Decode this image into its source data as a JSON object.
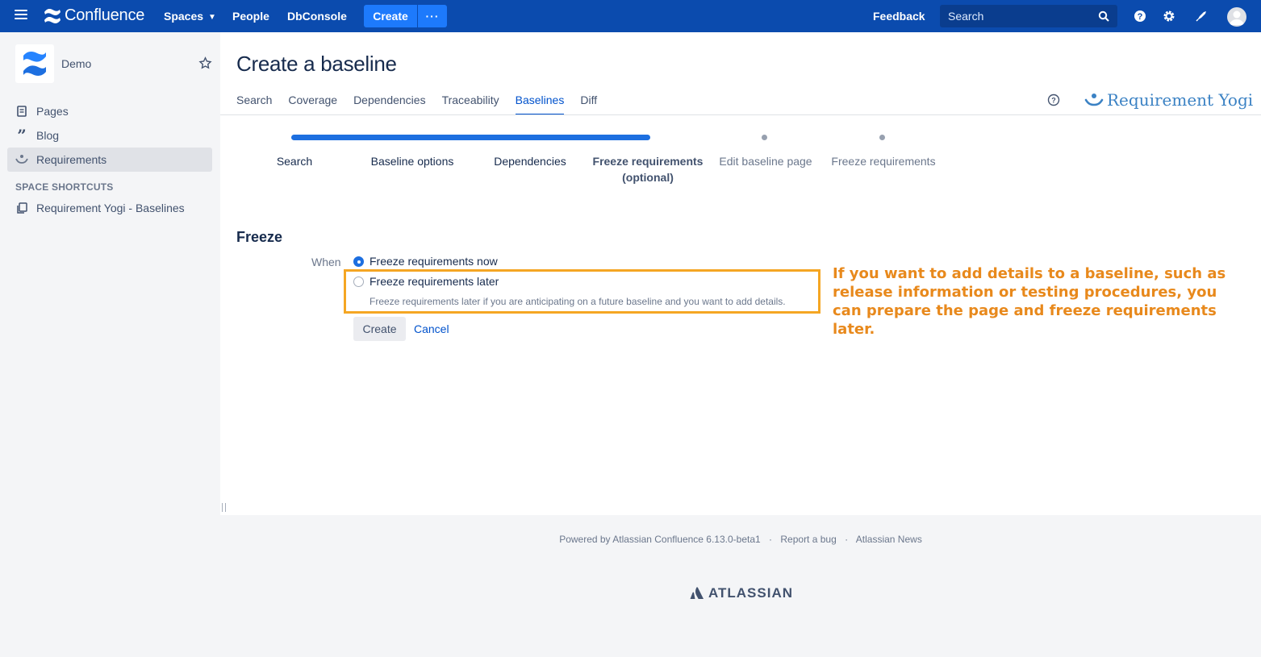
{
  "topnav": {
    "brand": "Confluence",
    "spaces": "Spaces",
    "people": "People",
    "dbconsole": "DbConsole",
    "create": "Create",
    "more": "···",
    "feedback": "Feedback",
    "search_placeholder": "Search"
  },
  "sidebar": {
    "space_name": "Demo",
    "items": [
      {
        "label": "Pages",
        "icon": "pages-icon"
      },
      {
        "label": "Blog",
        "icon": "blog-icon"
      },
      {
        "label": "Requirements",
        "icon": "requirements-icon"
      }
    ],
    "shortcuts_heading": "SPACE SHORTCUTS",
    "shortcuts": [
      {
        "label": "Requirement Yogi - Baselines",
        "icon": "copy-icon"
      }
    ]
  },
  "main": {
    "title": "Create a baseline",
    "tabs": [
      {
        "label": "Search"
      },
      {
        "label": "Coverage"
      },
      {
        "label": "Dependencies"
      },
      {
        "label": "Traceability"
      },
      {
        "label": "Baselines",
        "active": true
      },
      {
        "label": "Diff"
      }
    ],
    "brand_logo": "Requirement Yogi",
    "steps": [
      {
        "label": "Search"
      },
      {
        "label": "Baseline options"
      },
      {
        "label": "Dependencies"
      },
      {
        "label": "Freeze requirements (optional)"
      },
      {
        "label": "Edit baseline page"
      },
      {
        "label": "Freeze requirements"
      }
    ],
    "freeze_heading": "Freeze",
    "when_label": "When",
    "option_now": "Freeze requirements now",
    "option_later": "Freeze requirements later",
    "option_later_desc": "Freeze requirements later if you are anticipating on a future baseline and you want to add details.",
    "annotation_lines": [
      "If you want to add details to a baseline, such as",
      "release information or testing procedures, you",
      "can prepare the page and freeze requirements later."
    ],
    "create_button": "Create",
    "cancel_link": "Cancel"
  },
  "footer": {
    "powered_by": "Powered by Atlassian Confluence 6.13.0-beta1",
    "sep": "·",
    "report_bug": "Report a bug",
    "news": "Atlassian News",
    "atlassian": "ATLASSIAN"
  },
  "colors": {
    "nav_bg": "#0B4BAE",
    "create_btn": "#1D7AFC",
    "active_tab": "#0052CC",
    "annotation": "#E8891C",
    "highlight_border": "#F5A623"
  }
}
